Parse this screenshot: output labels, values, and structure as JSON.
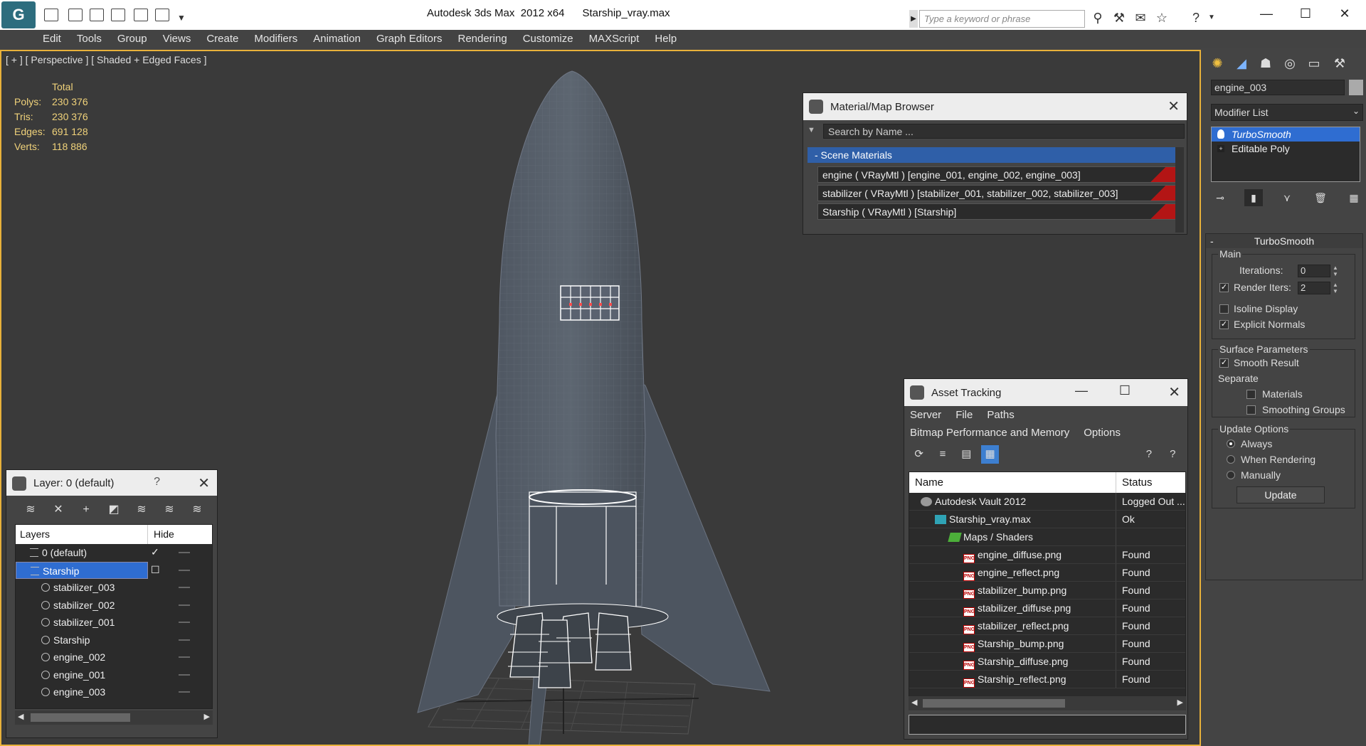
{
  "titlebar": {
    "app_title": "Autodesk 3ds Max  2012 x64",
    "file_name": "Starship_vray.max",
    "search_placeholder": "Type a keyword or phrase"
  },
  "menu": [
    "Edit",
    "Tools",
    "Group",
    "Views",
    "Create",
    "Modifiers",
    "Animation",
    "Graph Editors",
    "Rendering",
    "Customize",
    "MAXScript",
    "Help"
  ],
  "viewport": {
    "label": "[ + ] [ Perspective ] [ Shaded + Edged Faces ]",
    "stats": {
      "header": "Total",
      "rows": [
        {
          "label": "Polys:",
          "value": "230 376"
        },
        {
          "label": "Tris:",
          "value": "230 376"
        },
        {
          "label": "Edges:",
          "value": "691 128"
        },
        {
          "label": "Verts:",
          "value": "118 886"
        }
      ]
    }
  },
  "material_browser": {
    "title": "Material/Map Browser",
    "search_placeholder": "Search by Name ...",
    "section": "- Scene Materials",
    "items": [
      "engine  ( VRayMtl )  [engine_001, engine_002, engine_003]",
      "stabilizer  ( VRayMtl )  [stabilizer_001, stabilizer_002, stabilizer_003]",
      "Starship  ( VRayMtl )  [Starship]"
    ]
  },
  "asset_tracking": {
    "title": "Asset Tracking",
    "menu_row1": [
      "Server",
      "File",
      "Paths"
    ],
    "menu_row2": [
      "Bitmap Performance and Memory",
      "Options"
    ],
    "columns": {
      "name": "Name",
      "status": "Status"
    },
    "rows": [
      {
        "name": "Autodesk Vault 2012",
        "status": "Logged Out ...",
        "indent": 1,
        "icon": "vault-icon"
      },
      {
        "name": "Starship_vray.max",
        "status": "Ok",
        "indent": 2,
        "icon": "max-file-icon"
      },
      {
        "name": "Maps / Shaders",
        "status": "",
        "indent": 3,
        "icon": "maps-folder-icon"
      },
      {
        "name": "engine_diffuse.png",
        "status": "Found",
        "indent": 4,
        "icon": "png-icon"
      },
      {
        "name": "engine_reflect.png",
        "status": "Found",
        "indent": 4,
        "icon": "png-icon"
      },
      {
        "name": "stabilizer_bump.png",
        "status": "Found",
        "indent": 4,
        "icon": "png-icon"
      },
      {
        "name": "stabilizer_diffuse.png",
        "status": "Found",
        "indent": 4,
        "icon": "png-icon"
      },
      {
        "name": "stabilizer_reflect.png",
        "status": "Found",
        "indent": 4,
        "icon": "png-icon"
      },
      {
        "name": "Starship_bump.png",
        "status": "Found",
        "indent": 4,
        "icon": "png-icon"
      },
      {
        "name": "Starship_diffuse.png",
        "status": "Found",
        "indent": 4,
        "icon": "png-icon"
      },
      {
        "name": "Starship_reflect.png",
        "status": "Found",
        "indent": 4,
        "icon": "png-icon"
      }
    ]
  },
  "layer_panel": {
    "title": "Layer: 0 (default)",
    "help": "?",
    "columns": {
      "layers": "Layers",
      "hide": "Hide"
    },
    "rows": [
      {
        "name": "0 (default)",
        "type": "layer",
        "checked": true
      },
      {
        "name": "Starship",
        "type": "layer",
        "selected": true
      },
      {
        "name": "stabilizer_003",
        "type": "object"
      },
      {
        "name": "stabilizer_002",
        "type": "object"
      },
      {
        "name": "stabilizer_001",
        "type": "object"
      },
      {
        "name": "Starship",
        "type": "object"
      },
      {
        "name": "engine_002",
        "type": "object"
      },
      {
        "name": "engine_001",
        "type": "object"
      },
      {
        "name": "engine_003",
        "type": "object"
      }
    ]
  },
  "command_panel": {
    "object_name": "engine_003",
    "modifier_list": "Modifier List",
    "stack": [
      "TurboSmooth",
      "Editable Poly"
    ],
    "rollout_title": "TurboSmooth",
    "rollout_collapse": "-",
    "main_group": "Main",
    "iterations_label": "Iterations:",
    "iterations_value": "0",
    "render_iters_label": "Render Iters:",
    "render_iters_value": "2",
    "isoline_display": "Isoline Display",
    "explicit_normals": "Explicit Normals",
    "surface_parameters": "Surface Parameters",
    "smooth_result": "Smooth Result",
    "separate": "Separate",
    "materials": "Materials",
    "smoothing_groups": "Smoothing Groups",
    "update_options": "Update Options",
    "always": "Always",
    "when_rendering": "When Rendering",
    "manually": "Manually",
    "update_button": "Update"
  }
}
